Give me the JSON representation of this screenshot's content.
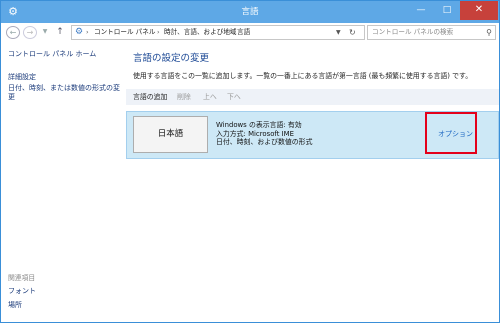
{
  "window": {
    "title": "言語",
    "icons": {
      "app": "language-clock-icon",
      "minimize": "minimize-icon",
      "maximize": "maximize-icon",
      "close": "close-icon"
    }
  },
  "nav": {
    "icons": {
      "back": "back-arrow-icon",
      "forward": "forward-arrow-icon",
      "recent": "recent-pages-dropdown-icon",
      "up": "up-arrow-icon"
    },
    "breadcrumbs": [
      "コントロール パネル",
      "時計、言語、および地域",
      "言語"
    ],
    "search_placeholder": "コントロール パネルの検索"
  },
  "sidebar": {
    "home": "コントロール パネル ホーム",
    "links": [
      "詳細設定",
      "日付、時刻、または数値の形式の変更"
    ],
    "related_header": "関連項目",
    "related": [
      "フォント",
      "場所"
    ]
  },
  "main": {
    "title": "言語の設定の変更",
    "description": "使用する言語をこの一覧に追加します。一覧の一番上にある言語が第一言語 (最も頻繁に使用する言語) です。",
    "toolbar": {
      "add": "言語の追加",
      "remove": "削除",
      "up": "上へ",
      "down": "下へ"
    },
    "language": {
      "name": "日本語",
      "details": [
        "Windows の表示言語: 有効",
        "入力方式: Microsoft IME",
        "日付、時刻、および数値の形式"
      ],
      "options": "オプション"
    },
    "highlight_color": "#e4001a"
  }
}
